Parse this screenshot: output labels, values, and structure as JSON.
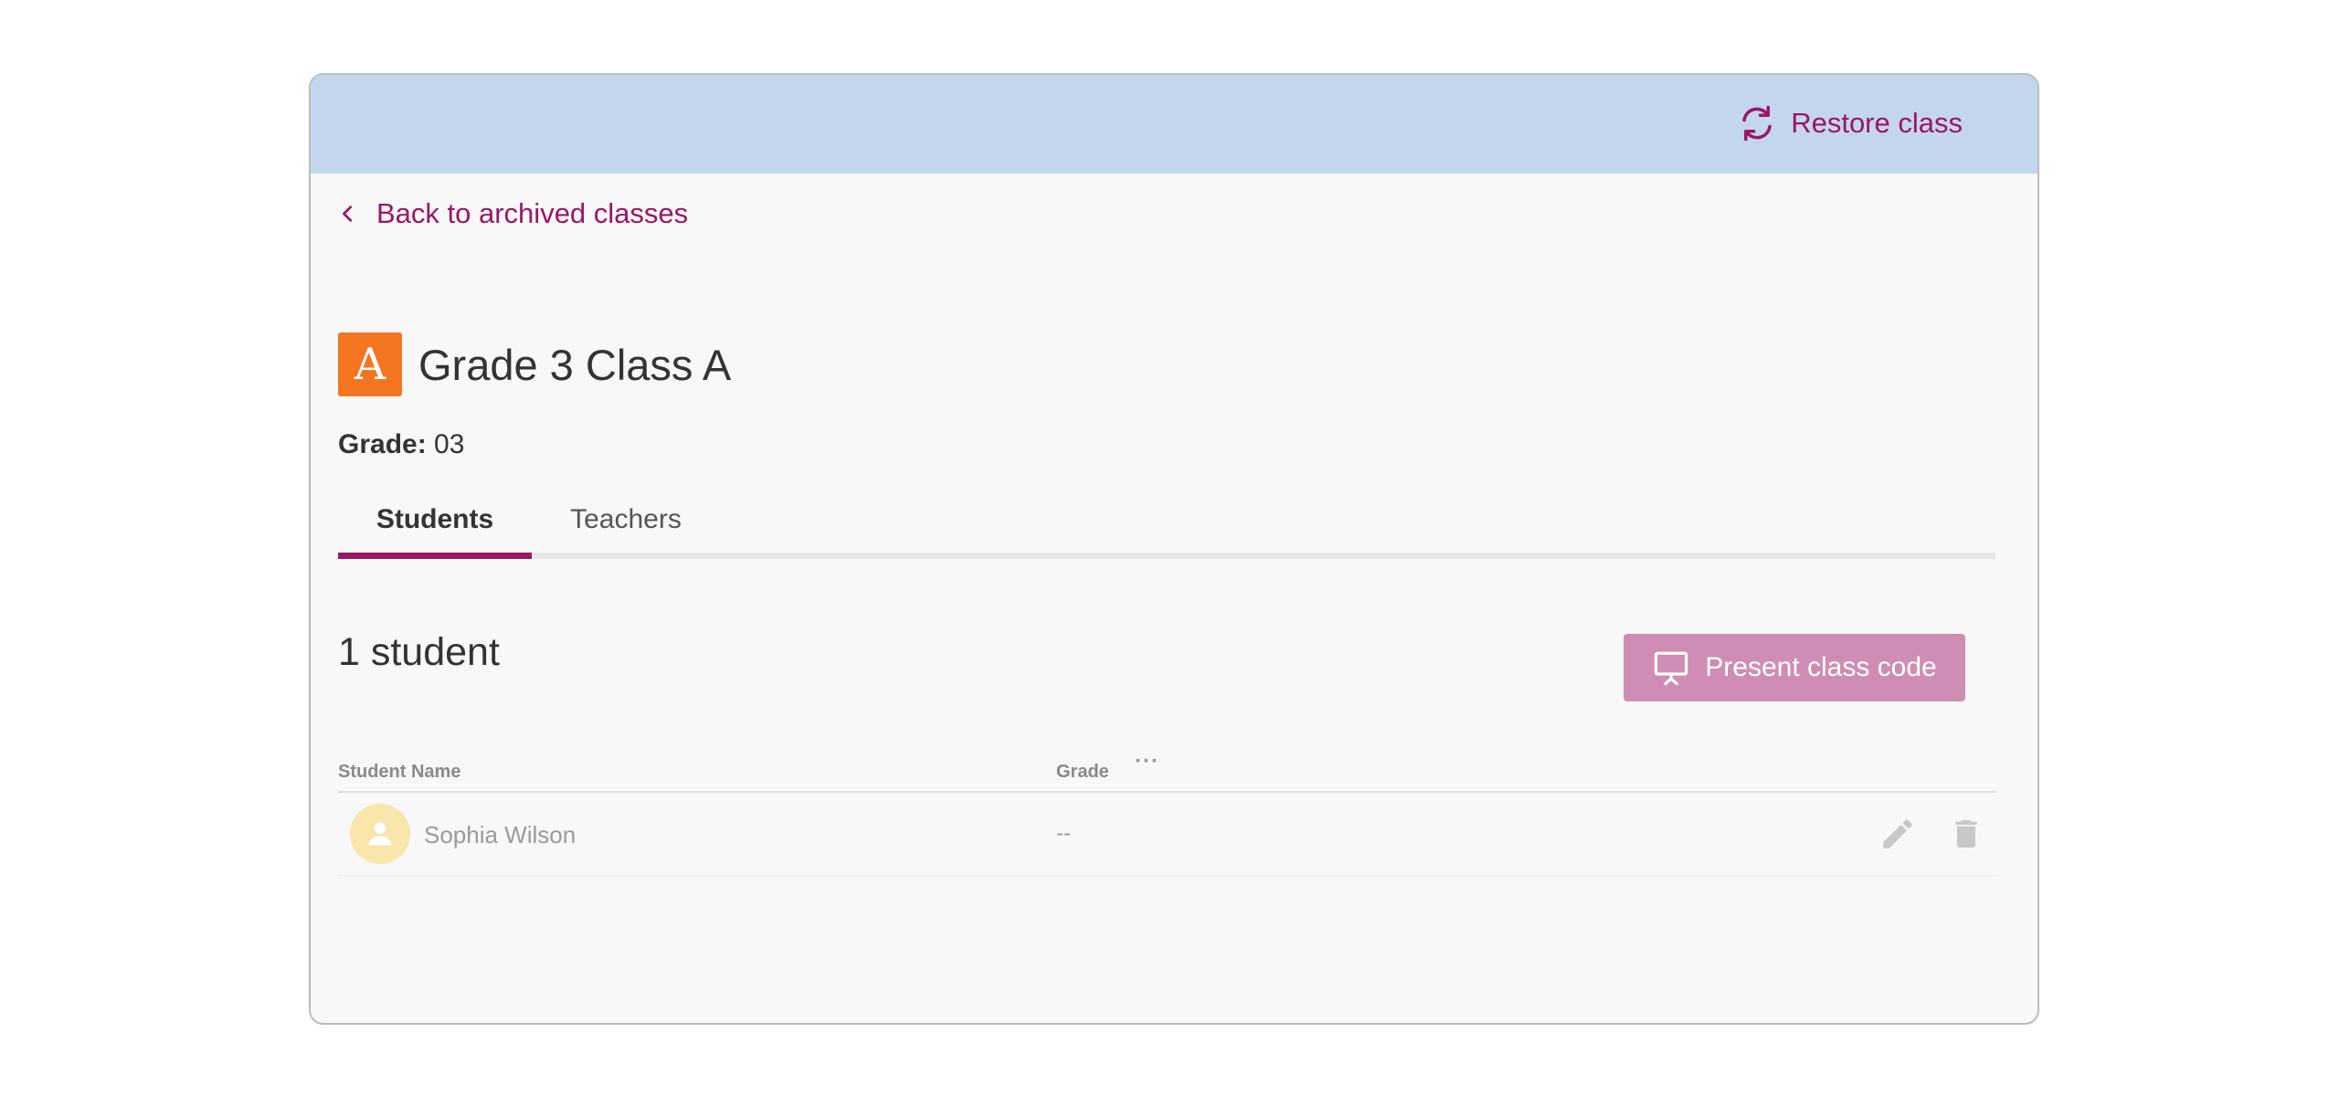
{
  "banner": {
    "restore_label": "Restore class",
    "restore_icon": "sync-icon",
    "background": "#c3d6ee"
  },
  "nav": {
    "back_label": "Back to archived classes",
    "back_icon": "chevron-left-icon"
  },
  "class": {
    "avatar_letter": "A",
    "avatar_color": "#f47521",
    "title": "Grade 3 Class A",
    "grade_label": "Grade:",
    "grade_value": "03"
  },
  "tabs": [
    {
      "label": "Students",
      "active": true
    },
    {
      "label": "Teachers",
      "active": false
    }
  ],
  "students": {
    "count_label": "1 student",
    "present_button_label": "Present class code",
    "present_icon": "presentation-icon",
    "columns": {
      "name": "Student Name",
      "grade": "Grade",
      "more": "···"
    },
    "rows": [
      {
        "name": "Sophia Wilson",
        "grade": "--",
        "avatar_icon": "person-icon"
      }
    ]
  },
  "colors": {
    "accent": "#9a1667",
    "button": "#d08db3"
  }
}
